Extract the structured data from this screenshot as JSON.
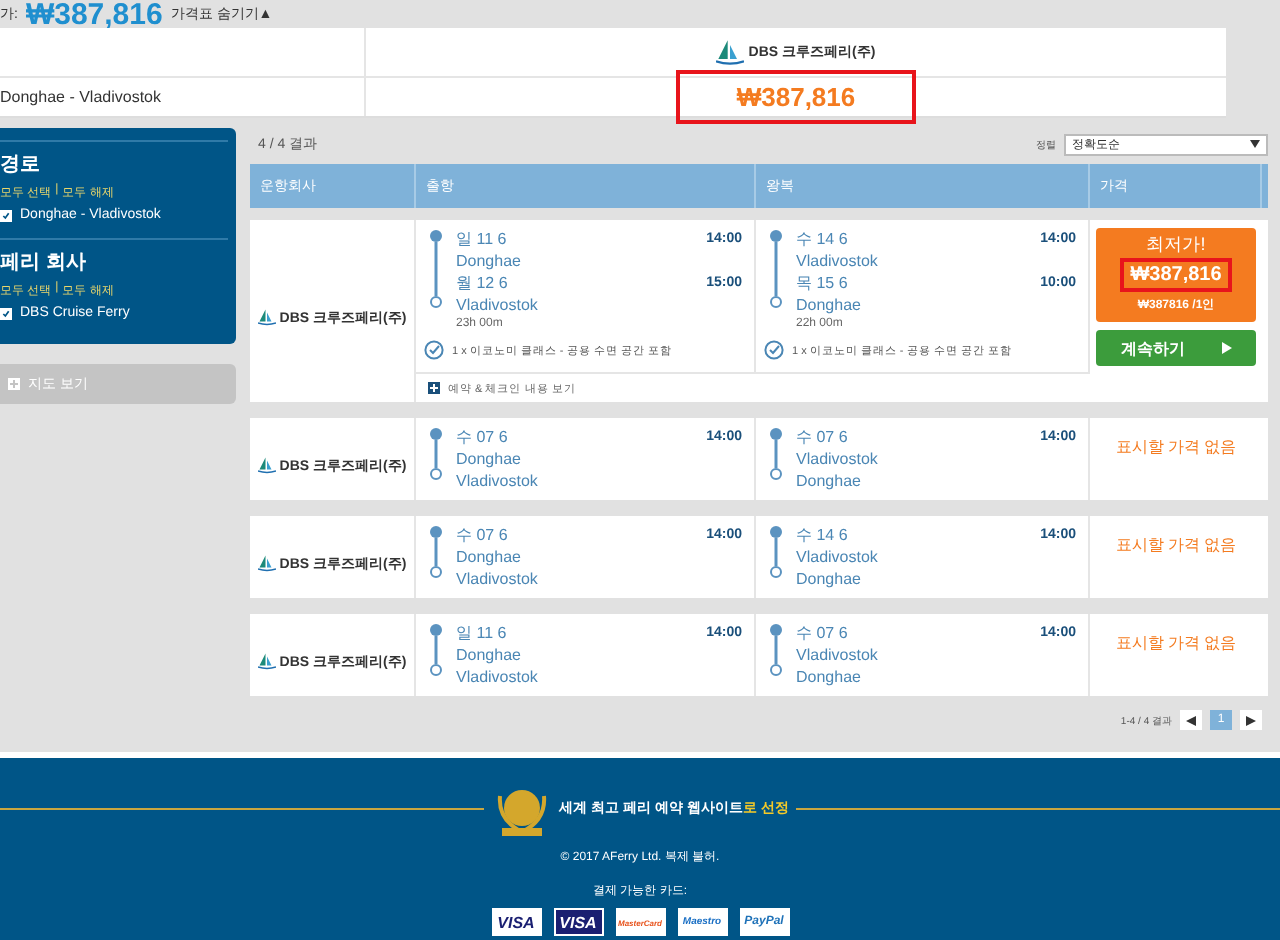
{
  "summary_bar": {
    "label": "가:",
    "price": "₩387,816",
    "toggle": "가격표 숨기기▲"
  },
  "price_table": {
    "logo_text": "DBS 크루즈페리(주)",
    "route": "Donghae - Vladivostok",
    "price": "₩387,816",
    "highlighted": true
  },
  "sidebar": {
    "filters": [
      {
        "title": "경로",
        "select_all": "모두 선택",
        "separator": "|",
        "clear_all": "모두 해제",
        "options": [
          {
            "label": "Donghae - Vladivostok",
            "checked": true
          }
        ]
      },
      {
        "title": "페리 회사",
        "select_all": "모두 선택",
        "separator": "|",
        "clear_all": "모두 해제",
        "options": [
          {
            "label": "DBS Cruise Ferry",
            "checked": true
          }
        ]
      }
    ],
    "map_button": "지도 보기"
  },
  "results": {
    "count": "4 / 4 결과",
    "sort_label": "정렬",
    "sort_value": "정확도순",
    "columns": [
      "운항회사",
      "출항",
      "왕복",
      "가격"
    ],
    "rows": [
      {
        "logo_text": "DBS 크루즈페리(주)",
        "outbound": {
          "dep_day": "일 11 6",
          "dep_place": "Donghae",
          "dep_time": "14:00",
          "arr_day": "월 12 6",
          "arr_place": "Vladivostok",
          "arr_time": "15:00",
          "duration": "23h 00m",
          "fare": "1 x 이코노미 클래스 - 공용 수면 공간 포함"
        },
        "return": {
          "dep_day": "수 14 6",
          "dep_place": "Vladivostok",
          "dep_time": "14:00",
          "arr_day": "목 15 6",
          "arr_place": "Donghae",
          "arr_time": "10:00",
          "duration": "22h 00m",
          "fare": "1 x 이코노미 클래스 - 공용 수면 공간 포함"
        },
        "details_link": "예약 & 체크인 내용 보기",
        "price": {
          "kind": "offer",
          "badge": "최저가!",
          "amount": "₩387,816",
          "per_person": "₩387816 /1인",
          "button": "계속하기"
        }
      },
      {
        "logo_text": "DBS 크루즈페리(주)",
        "outbound": {
          "dep_day": "수 07 6",
          "dep_place": "Donghae",
          "dep_time": "14:00",
          "arr_place": "Vladivostok"
        },
        "return": {
          "dep_day": "수 07 6",
          "dep_place": "Vladivostok",
          "dep_time": "14:00",
          "arr_place": "Donghae"
        },
        "price": {
          "kind": "none",
          "message": "표시할 가격 없음"
        }
      },
      {
        "logo_text": "DBS 크루즈페리(주)",
        "outbound": {
          "dep_day": "수 07 6",
          "dep_place": "Donghae",
          "dep_time": "14:00",
          "arr_place": "Vladivostok"
        },
        "return": {
          "dep_day": "수 14 6",
          "dep_place": "Vladivostok",
          "dep_time": "14:00",
          "arr_place": "Donghae"
        },
        "price": {
          "kind": "none",
          "message": "표시할 가격 없음"
        }
      },
      {
        "logo_text": "DBS 크루즈페리(주)",
        "outbound": {
          "dep_day": "일 11 6",
          "dep_place": "Donghae",
          "dep_time": "14:00",
          "arr_place": "Vladivostok"
        },
        "return": {
          "dep_day": "수 07 6",
          "dep_place": "Vladivostok",
          "dep_time": "14:00",
          "arr_place": "Donghae"
        },
        "price": {
          "kind": "none",
          "message": "표시할 가격 없음"
        }
      }
    ],
    "pagination": {
      "summary": "1-4 / 4 결과",
      "pages": [
        {
          "label": "1",
          "selected": true
        }
      ]
    }
  },
  "footer": {
    "award_text": "세계 최고 페리 예약 웹사이트",
    "award_highlight": "로 선정",
    "copyright": "© 2017 AFerry Ltd. 복제 불허.",
    "cards_label": "결제 가능한 카드:",
    "cards": [
      {
        "label": "VISA",
        "kind": "visa"
      },
      {
        "label": "VISA",
        "kind": "visa-electron"
      },
      {
        "label": "MasterCard",
        "kind": "mastercard"
      },
      {
        "label": "Maestro",
        "kind": "maestro"
      },
      {
        "label": "PayPal",
        "kind": "paypal"
      }
    ]
  }
}
